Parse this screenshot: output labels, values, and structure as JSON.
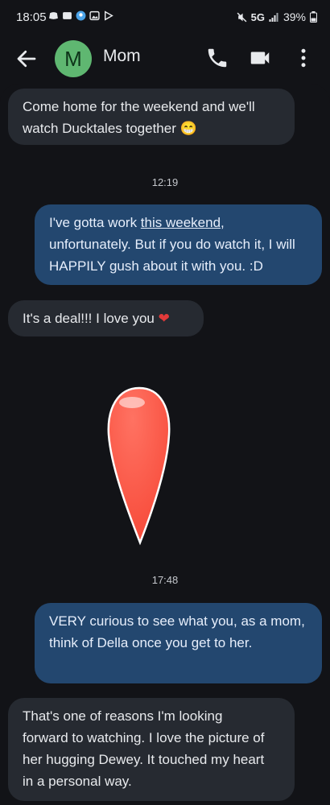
{
  "status": {
    "time": "18:05",
    "network": "5G",
    "battery": "39%"
  },
  "header": {
    "avatar_letter": "M",
    "contact_name": "Mom",
    "avatar_color": "#5fb771"
  },
  "messages": [
    {
      "direction": "incoming",
      "line1": "Come home for the weekend and we'll",
      "line2": "watch Ducktales together",
      "emoji": "😁"
    },
    {
      "timestamp": "12:19"
    },
    {
      "direction": "outgoing",
      "pre": "I've gotta work ",
      "link": "this weekend",
      "post": ", unfortunately. But if you do watch it, I will HAPPILY gush about it with you. :D"
    },
    {
      "direction": "incoming",
      "text": "It's a deal!!! I love you",
      "emoji": "❤"
    },
    {
      "sticker": "red-drop-sticker"
    },
    {
      "timestamp": "17:48"
    },
    {
      "direction": "outgoing",
      "text": "VERY curious to see what you, as a mom, think of Della once you get to her."
    },
    {
      "direction": "incoming",
      "text": "That's one of reasons I'm looking forward to watching. I love the picture of her hugging Dewey. It touched my heart in a personal way."
    }
  ],
  "colors": {
    "background": "#121317",
    "incoming_bubble": "#262a31",
    "outgoing_bubble": "#23476f",
    "sticker": "#fb5a48"
  }
}
